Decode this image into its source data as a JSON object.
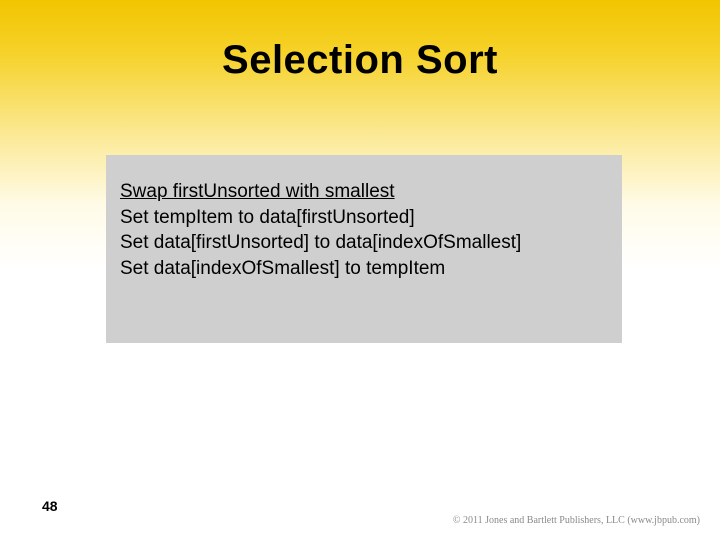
{
  "slide": {
    "title": "Selection Sort",
    "page_number": "48",
    "copyright": "© 2011 Jones and Bartlett Publishers, LLC (www.jbpub.com)"
  },
  "code": {
    "heading": "Swap firstUnsorted with smallest",
    "lines": [
      "Set tempItem to data[firstUnsorted]",
      "Set data[firstUnsorted] to data[indexOfSmallest]",
      "Set data[indexOfSmallest] to tempItem"
    ]
  }
}
